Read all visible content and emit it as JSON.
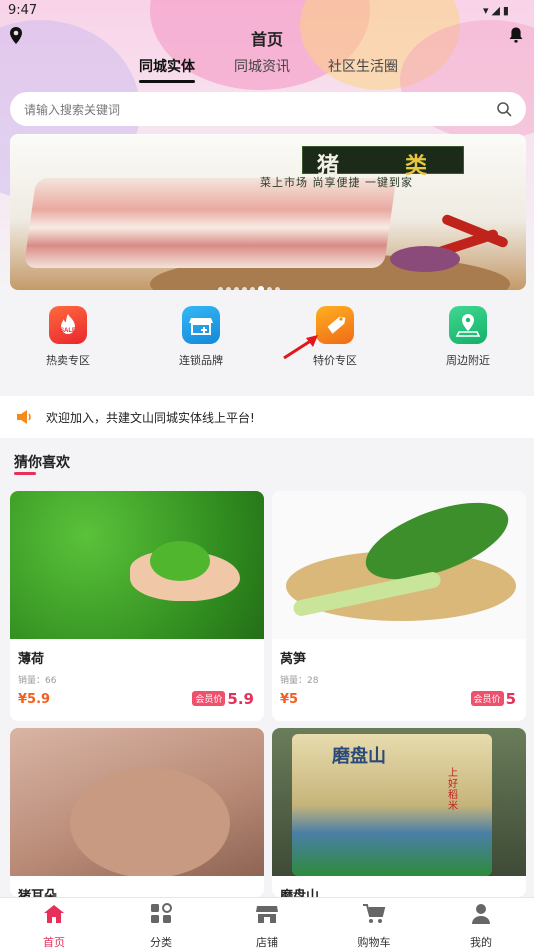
{
  "status_bar": {
    "time": "9:47"
  },
  "header": {
    "title": "首页"
  },
  "tabs": [
    {
      "label": "同城实体",
      "active": true
    },
    {
      "label": "同城资讯",
      "active": false
    },
    {
      "label": "社区生活圈",
      "active": false
    }
  ],
  "search": {
    "placeholder": "请输入搜索关键词"
  },
  "banner": {
    "title_part1": "猪",
    "title_part2": "类",
    "subtitle": "菜上市场  尚享便捷    一键到家",
    "slide_count": 8,
    "active_slide": 6
  },
  "categories": [
    {
      "label": "热卖专区",
      "icon": "sale-icon",
      "color": "#f2463a"
    },
    {
      "label": "连锁品牌",
      "icon": "store-plus-icon",
      "color": "#1ea0e8"
    },
    {
      "label": "特价专区",
      "icon": "tag-icon",
      "color": "#f58a18"
    },
    {
      "label": "周边附近",
      "icon": "map-pin-icon",
      "color": "#22c07a"
    }
  ],
  "notice": {
    "text": "欢迎加入，共建文山同城实体线上平台!"
  },
  "section": {
    "title": "猜你喜欢"
  },
  "products": [
    {
      "name": "薄荷",
      "sales": "销量：66",
      "price": "¥5.9",
      "vip_tag": "会员价",
      "vip_price": "5.9"
    },
    {
      "name": "莴笋",
      "sales": "销量：28",
      "price": "¥5",
      "vip_tag": "会员价",
      "vip_price": "5"
    },
    {
      "name": "猪耳朵"
    },
    {
      "name": "磨盘山",
      "package_text_large": "磨盘山",
      "package_text_small": "上好稻米"
    }
  ],
  "bottom_nav": [
    {
      "label": "首页",
      "icon": "home-icon",
      "active": true
    },
    {
      "label": "分类",
      "icon": "grid-icon",
      "active": false
    },
    {
      "label": "店铺",
      "icon": "shop-icon",
      "active": false
    },
    {
      "label": "购物车",
      "icon": "cart-icon",
      "active": false
    },
    {
      "label": "我的",
      "icon": "user-icon",
      "active": false
    }
  ],
  "colors": {
    "accent": "#e6305a",
    "price": "#f06020"
  }
}
